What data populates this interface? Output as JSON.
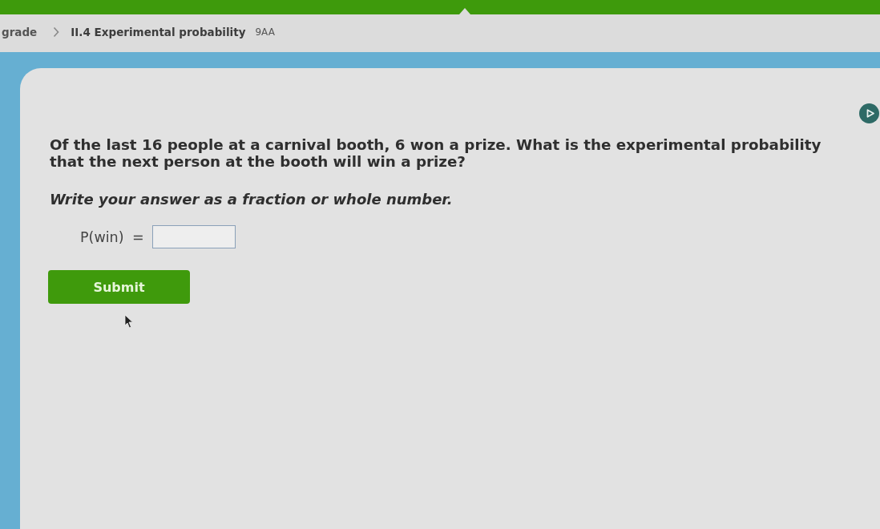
{
  "breadcrumb": {
    "parent": "grade",
    "current": "II.4 Experimental probability",
    "code": "9AA"
  },
  "question": {
    "prompt": "Of the last 16 people at a carnival booth, 6 won a prize. What is the experimental probability that the next person at the booth will win a prize?",
    "instruction": "Write your answer as a fraction or whole number.",
    "answer": {
      "label": "P(win) ="
    },
    "submit": "Submit"
  }
}
